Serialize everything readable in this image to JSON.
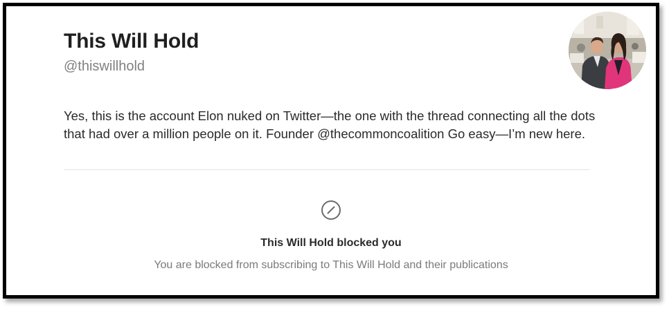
{
  "profile": {
    "display_name": "This Will Hold",
    "handle": "@thiswillhold",
    "avatar_icon": "profile-photo",
    "bio": "Yes, this is the account Elon nuked on Twitter—the one with the thread connecting all the dots that had over a million people on it. Founder @thecommoncoalition Go easy—I’m new here."
  },
  "blocked": {
    "icon": "blocked-circle-icon",
    "title": "This Will Hold blocked you",
    "message": "You are blocked from subscribing to This Will Hold and their publications"
  },
  "colors": {
    "frame_border": "#000000",
    "text_primary": "#1f1f1f",
    "text_secondary": "#808080",
    "divider": "#e3e3e3"
  }
}
